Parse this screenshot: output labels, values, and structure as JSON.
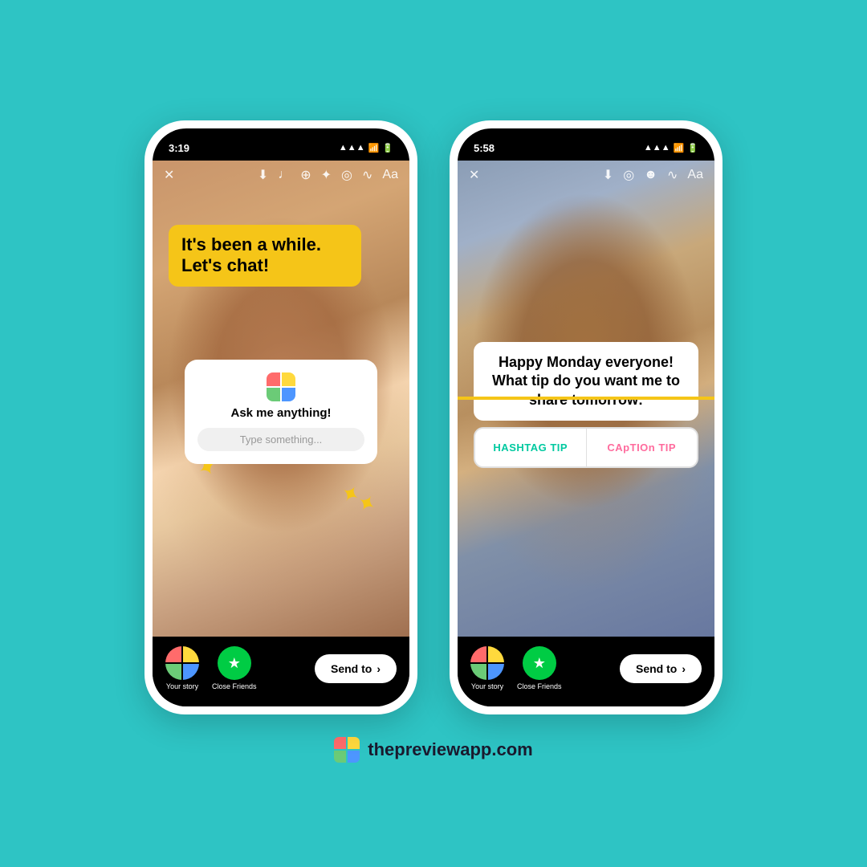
{
  "background_color": "#2ec4c4",
  "footer": {
    "logo_alt": "preview app logo",
    "website": "thepreviewapp.com"
  },
  "phone1": {
    "status_time": "3:19",
    "toolbar": {
      "close": "✕",
      "download": "⬇",
      "music": "♪",
      "link": "🔗",
      "sparkle": "✦",
      "face": "☺",
      "sound": "🔇",
      "text": "Aa"
    },
    "text_sticker": "It's been a while. Let's chat!",
    "question_sticker": {
      "ask_label": "Ask me anything!",
      "placeholder": "Type something..."
    },
    "bottom": {
      "story_label": "Your story",
      "close_friends_label": "Close Friends",
      "send_to": "Send to"
    }
  },
  "phone2": {
    "status_time": "5:58",
    "toolbar": {
      "close": "✕",
      "download": "⬇",
      "face1": "☺",
      "face2": "☻",
      "sound": "🔇",
      "text": "Aa"
    },
    "poll_text": "Happy Monday everyone! What tip do you want me to share tomorrow:",
    "poll_options": {
      "left": "HASHTAG TIP",
      "right": "CApTIOn TIP"
    },
    "bottom": {
      "story_label": "Your story",
      "close_friends_label": "Close Friends",
      "send_to": "Send to"
    }
  }
}
